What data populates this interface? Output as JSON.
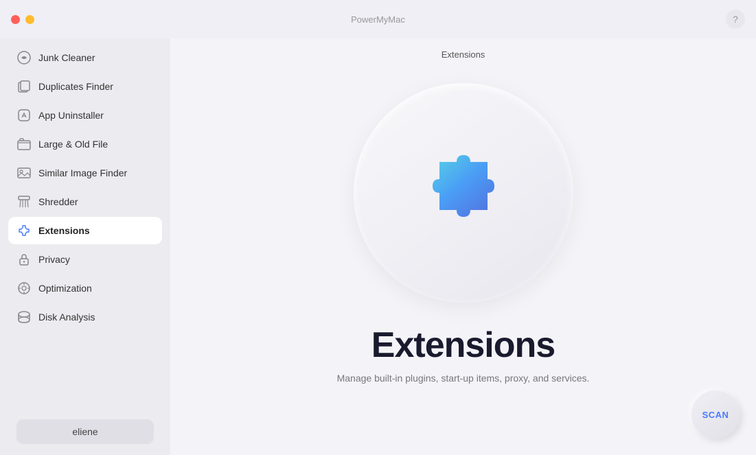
{
  "titlebar": {
    "app_name": "PowerMyMac",
    "help_label": "?"
  },
  "header": {
    "title": "Extensions"
  },
  "sidebar": {
    "items": [
      {
        "id": "junk-cleaner",
        "label": "Junk Cleaner",
        "active": false
      },
      {
        "id": "duplicates-finder",
        "label": "Duplicates Finder",
        "active": false
      },
      {
        "id": "app-uninstaller",
        "label": "App Uninstaller",
        "active": false
      },
      {
        "id": "large-old-file",
        "label": "Large & Old File",
        "active": false
      },
      {
        "id": "similar-image-finder",
        "label": "Similar Image Finder",
        "active": false
      },
      {
        "id": "shredder",
        "label": "Shredder",
        "active": false
      },
      {
        "id": "extensions",
        "label": "Extensions",
        "active": true
      },
      {
        "id": "privacy",
        "label": "Privacy",
        "active": false
      },
      {
        "id": "optimization",
        "label": "Optimization",
        "active": false
      },
      {
        "id": "disk-analysis",
        "label": "Disk Analysis",
        "active": false
      }
    ],
    "user_label": "eliene"
  },
  "content": {
    "title": "Extensions",
    "feature_title": "Extensions",
    "feature_desc": "Manage built-in plugins, start-up items, proxy, and services.",
    "scan_label": "SCAN"
  }
}
